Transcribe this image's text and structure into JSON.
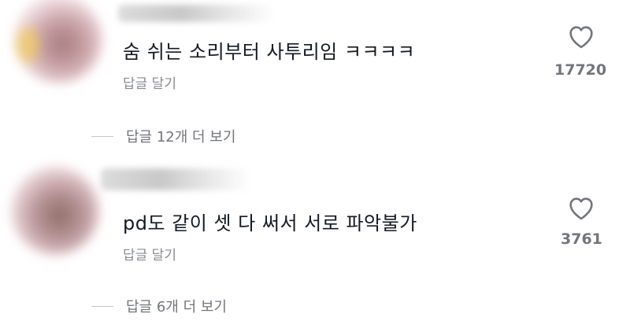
{
  "comments": [
    {
      "text": "숨 쉬는 소리부터 사투리임 ㅋㅋㅋㅋ",
      "reply_label": "답글 달기",
      "like_count": "17720",
      "view_replies_label": "답글 12개 더 보기"
    },
    {
      "text": "pd도 같이 셋 다 써서 서로 파악불가",
      "reply_label": "답글 달기",
      "like_count": "3761",
      "view_replies_label": "답글 6개 더 보기"
    }
  ]
}
